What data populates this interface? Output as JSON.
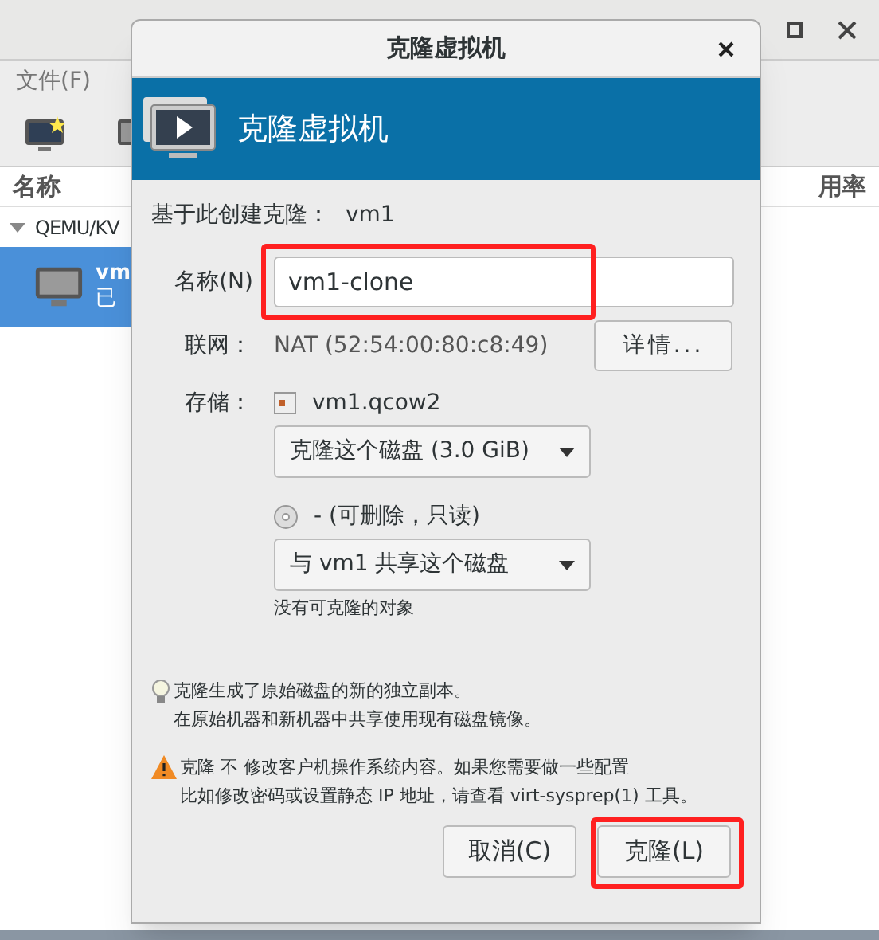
{
  "background_window": {
    "menu": [
      "文件(F)"
    ],
    "column_headers": [
      "名称",
      "用率"
    ],
    "tree": [
      {
        "label": "QEMU/KV",
        "expanded": true,
        "children": [
          {
            "name": "vm",
            "status": "已",
            "selected": true
          }
        ]
      }
    ]
  },
  "dialog": {
    "title": "克隆虚拟机",
    "banner_title": "克隆虚拟机",
    "source_label": "基于此创建克隆：",
    "source_value": "vm1",
    "name_field": {
      "label": "名称(N)",
      "value": "vm1-clone",
      "highlighted": true
    },
    "network": {
      "label": "联网：",
      "value": "NAT (52:54:00:80:c8:49)",
      "button": "详情..."
    },
    "storage": {
      "label": "存储：",
      "disks": [
        {
          "kind": "disk",
          "name": "vm1.qcow2",
          "action": "克隆这个磁盘 (3.0 GiB)"
        },
        {
          "kind": "cdrom",
          "name": "- (可删除，只读)",
          "action": "与 vm1 共享这个磁盘",
          "note": "没有可克隆的对象"
        }
      ]
    },
    "notes": [
      {
        "kind": "tip",
        "lines": [
          "克隆生成了原始磁盘的新的独立副本。",
          "在原始机器和新机器中共享使用现有磁盘镜像。"
        ]
      },
      {
        "kind": "warning",
        "lines": [
          "克隆 不 修改客户机操作系统内容。如果您需要做一些配置",
          "比如修改密码或设置静态 IP 地址，请查看 virt-sysprep(1) 工具。"
        ]
      }
    ],
    "buttons": [
      {
        "label": "取消(C)",
        "highlighted": false
      },
      {
        "label": "克隆(L)",
        "highlighted": true
      }
    ]
  }
}
